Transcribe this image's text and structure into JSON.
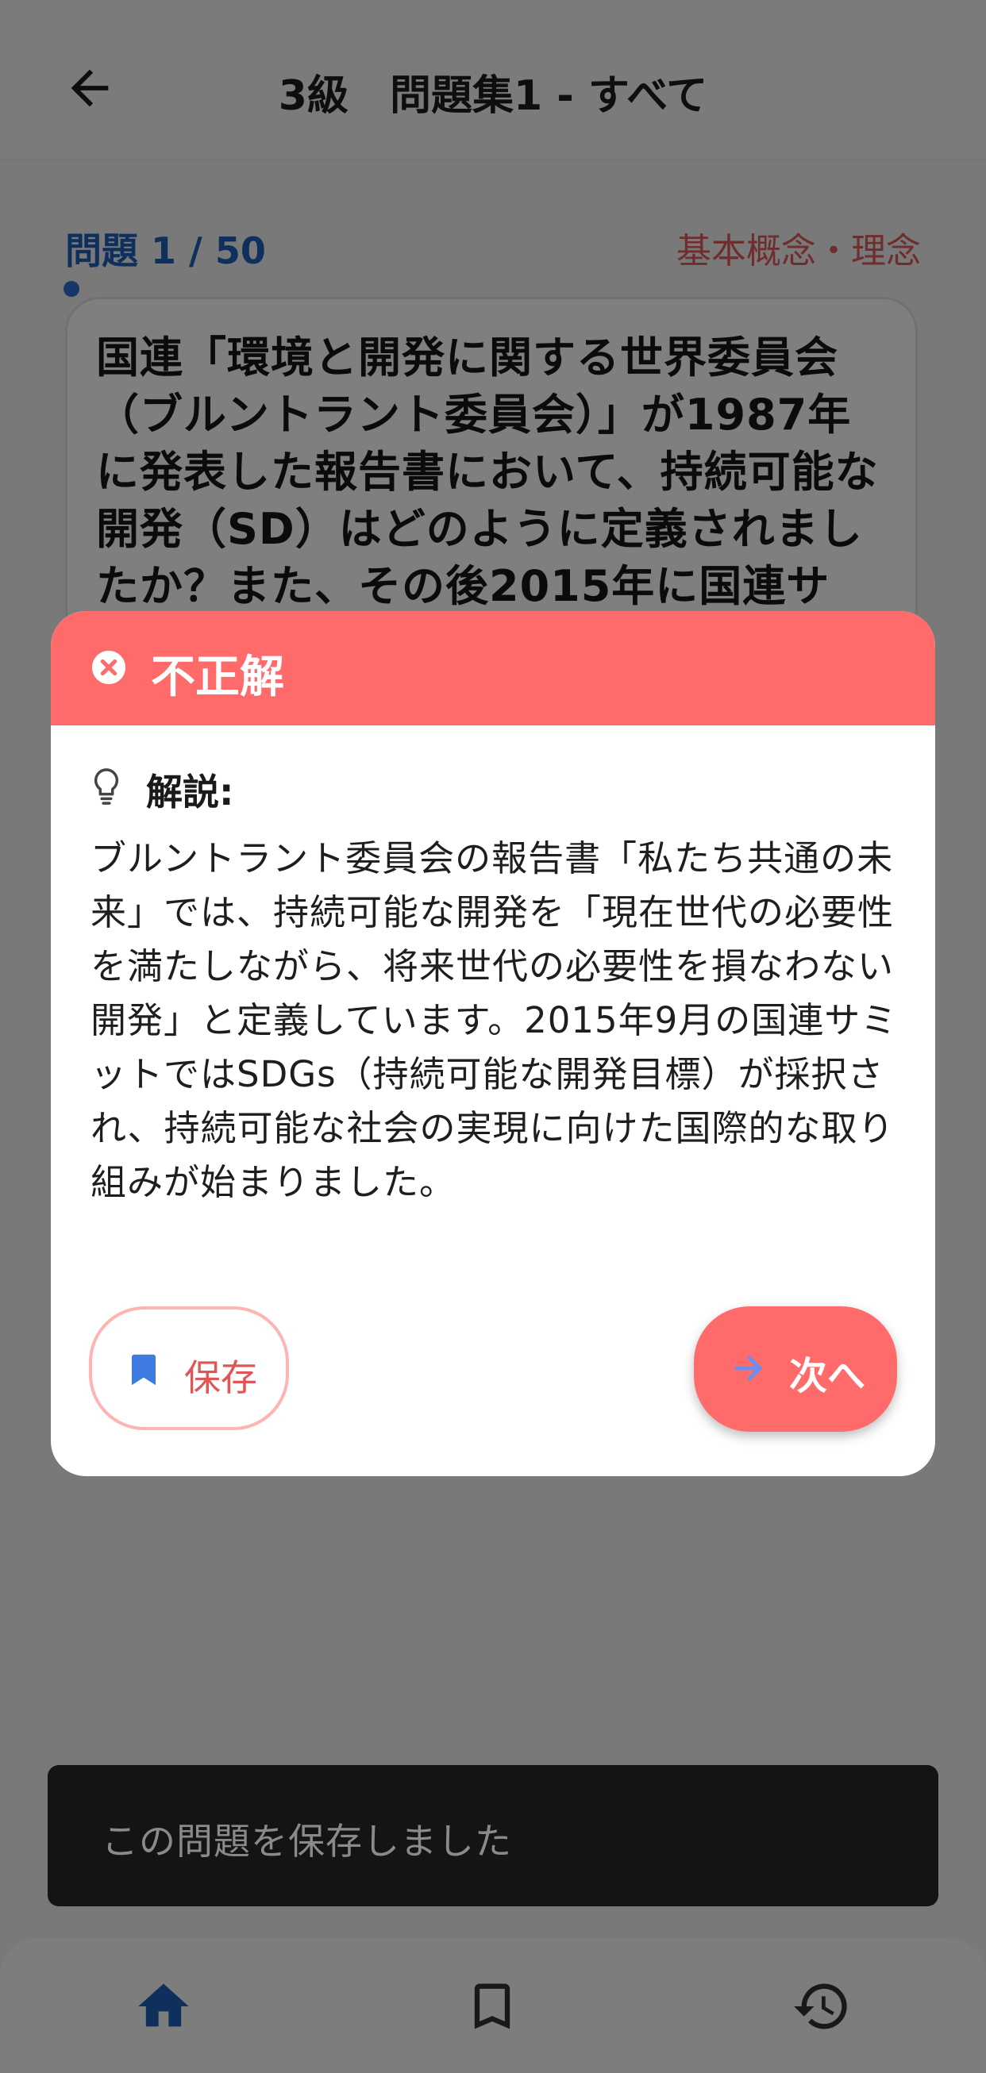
{
  "appbar": {
    "title": "3級　問題集1 - すべて",
    "back_icon": "arrow-left-icon"
  },
  "quiz": {
    "progress": "問題 1 / 50",
    "progress_fraction": 0.02,
    "category": "基本概念・理念",
    "question": "国連「環境と開発に関する世界委員会（ブルントラント委員会）」が1987年に発表した報告書において、持続可能な開発（SD）はどのように定義されましたか？また、その後2015年に国連サ"
  },
  "dialog": {
    "status_icon": "close-circle-icon",
    "title": "不正解",
    "explain_icon": "lightbulb-icon",
    "explain_label": "解説:",
    "explain_text": "ブルントラント委員会の報告書「私たち共通の未来」では、持続可能な開発を「現在世代の必要性を満たしながら、将来世代の必要性を損なわない開発」と定義しています。2015年9月の国連サミットではSDGs（持続可能な開発目標）が採択され、持続可能な社会の実現に向けた国際的な取り組みが始まりました。",
    "save_button": "保存",
    "next_button": "次へ"
  },
  "snackbar": {
    "message": "この問題を保存しました"
  },
  "bottom_nav": {
    "items": [
      {
        "icon": "home-icon",
        "active": true
      },
      {
        "icon": "bookmark-icon",
        "active": false
      },
      {
        "icon": "history-icon",
        "active": false
      }
    ]
  },
  "colors": {
    "accent_blue": "#1f5fb8",
    "incorrect_red": "#ff6b6b",
    "category_red": "#e15b5b",
    "snackbar_bg": "#141416"
  }
}
